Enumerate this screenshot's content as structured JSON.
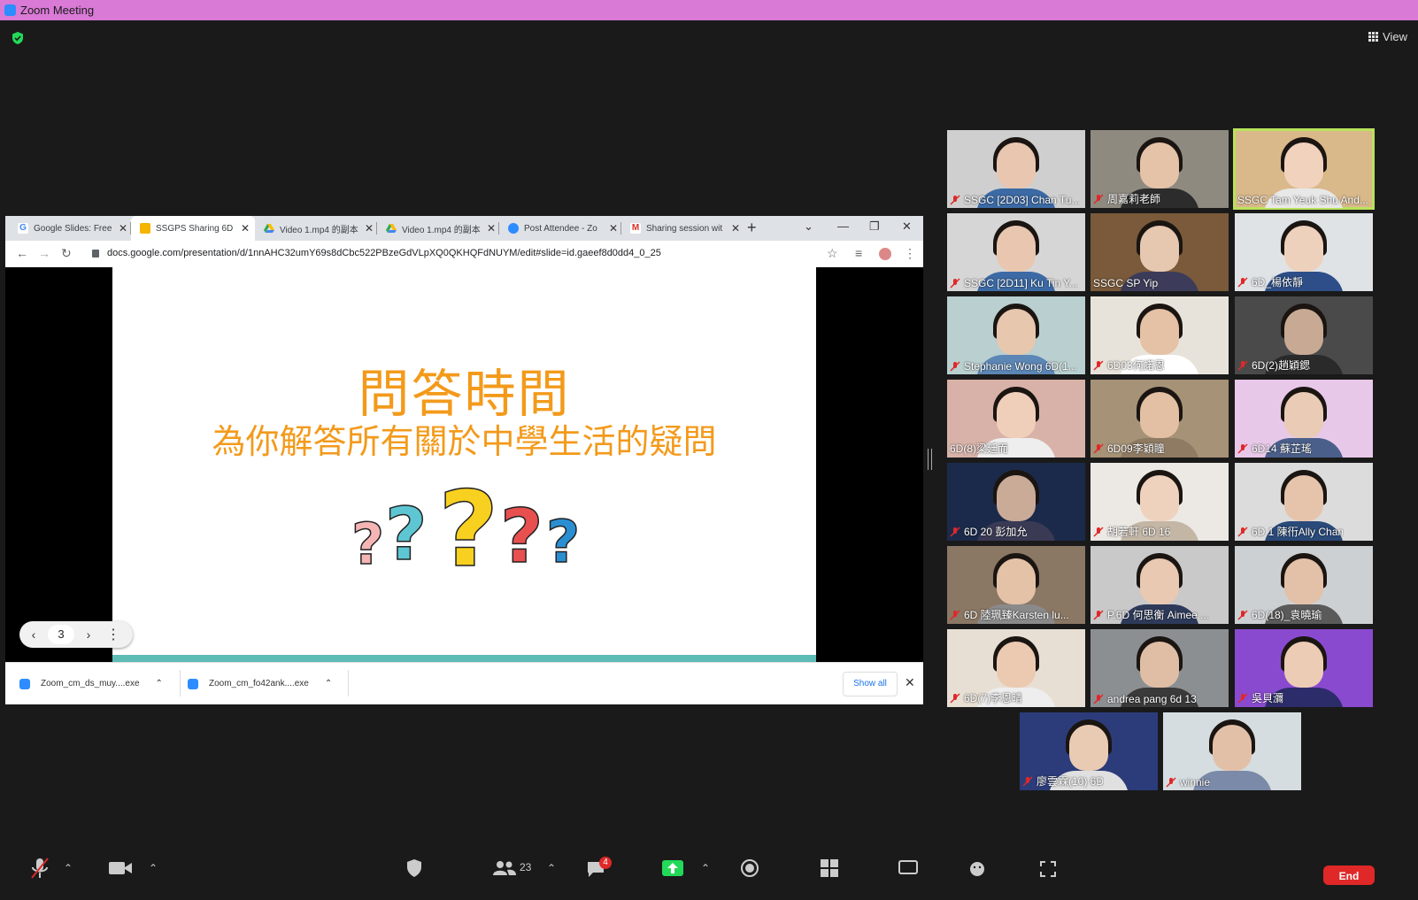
{
  "window": {
    "title": "Zoom Meeting"
  },
  "top_bar": {
    "view_label": "View"
  },
  "browser": {
    "tabs": [
      {
        "label": "Google Slides: Free",
        "icon": "google-icon",
        "color": "#4285f4"
      },
      {
        "label": "SSGPS Sharing 6D",
        "icon": "slides-icon",
        "color": "#f4b400"
      },
      {
        "label": "Video 1.mp4 的副本",
        "icon": "drive-icon",
        "color": "#34a853"
      },
      {
        "label": "Video 1.mp4 的副本",
        "icon": "drive-icon",
        "color": "#34a853"
      },
      {
        "label": "Post Attendee - Zo",
        "icon": "zoom-icon",
        "color": "#2d8cff"
      },
      {
        "label": "Sharing session wit",
        "icon": "gmail-icon",
        "color": "#d93025"
      }
    ],
    "active_tab": 1,
    "url": "docs.google.com/presentation/d/1nnAHC32umY69s8dCbc522PBzeGdVLpXQ0QKHQFdNUYM/edit#slide=id.gaeef8d0dd4_0_25"
  },
  "slide": {
    "title": "問答時間",
    "subtitle": "為你解答所有關於中學生活的疑問",
    "page_number": "3",
    "accent": "#f39a1b"
  },
  "downloads": {
    "items": [
      {
        "name": "Zoom_cm_ds_muy....exe"
      },
      {
        "name": "Zoom_cm_fo42ank....exe"
      }
    ],
    "show_all": "Show all"
  },
  "participants": [
    {
      "name": "SSGC [2D03] Chan Tu...",
      "muted": true
    },
    {
      "name": "周嘉莉老師",
      "muted": true
    },
    {
      "name": "SSGC Tam Yeuk Shu And...",
      "muted": false,
      "active": true
    },
    {
      "name": "SSGC [2D11] Ku Tin Y...",
      "muted": true
    },
    {
      "name": "SSGC SP Yip",
      "muted": false
    },
    {
      "name": "6D_楊依靜",
      "muted": true
    },
    {
      "name": "Stephanie Wong 6D(1...",
      "muted": true
    },
    {
      "name": "6D03何諾恩",
      "muted": true
    },
    {
      "name": "6D(2)趙穎鍶",
      "muted": true
    },
    {
      "name": "6D(8)梁廷而",
      "muted": false
    },
    {
      "name": "6D09李穎瞳",
      "muted": true
    },
    {
      "name": "6D14 蘇芷瑤",
      "muted": true
    },
    {
      "name": "6D 20 彭加允",
      "muted": true
    },
    {
      "name": "胡若軒 6D 16",
      "muted": true
    },
    {
      "name": "6D 1 陳衎Ally Chan",
      "muted": true
    },
    {
      "name": "6D 陸珮臻Karsten lu...",
      "muted": true
    },
    {
      "name": "P.6D 何思衡 Aimee ...",
      "muted": true
    },
    {
      "name": "6D(18)_袁曉瑜",
      "muted": true
    },
    {
      "name": "6D(7)李恩晴",
      "muted": true
    },
    {
      "name": "andrea pang 6d 13",
      "muted": true
    },
    {
      "name": "吳貝瀰",
      "muted": true
    },
    {
      "name": "廖雲霖(10) 6D",
      "muted": true
    },
    {
      "name": "winnie",
      "muted": true
    }
  ],
  "toolbar": {
    "participants_count": "23",
    "chat_badge": "4",
    "end_label": "End"
  }
}
